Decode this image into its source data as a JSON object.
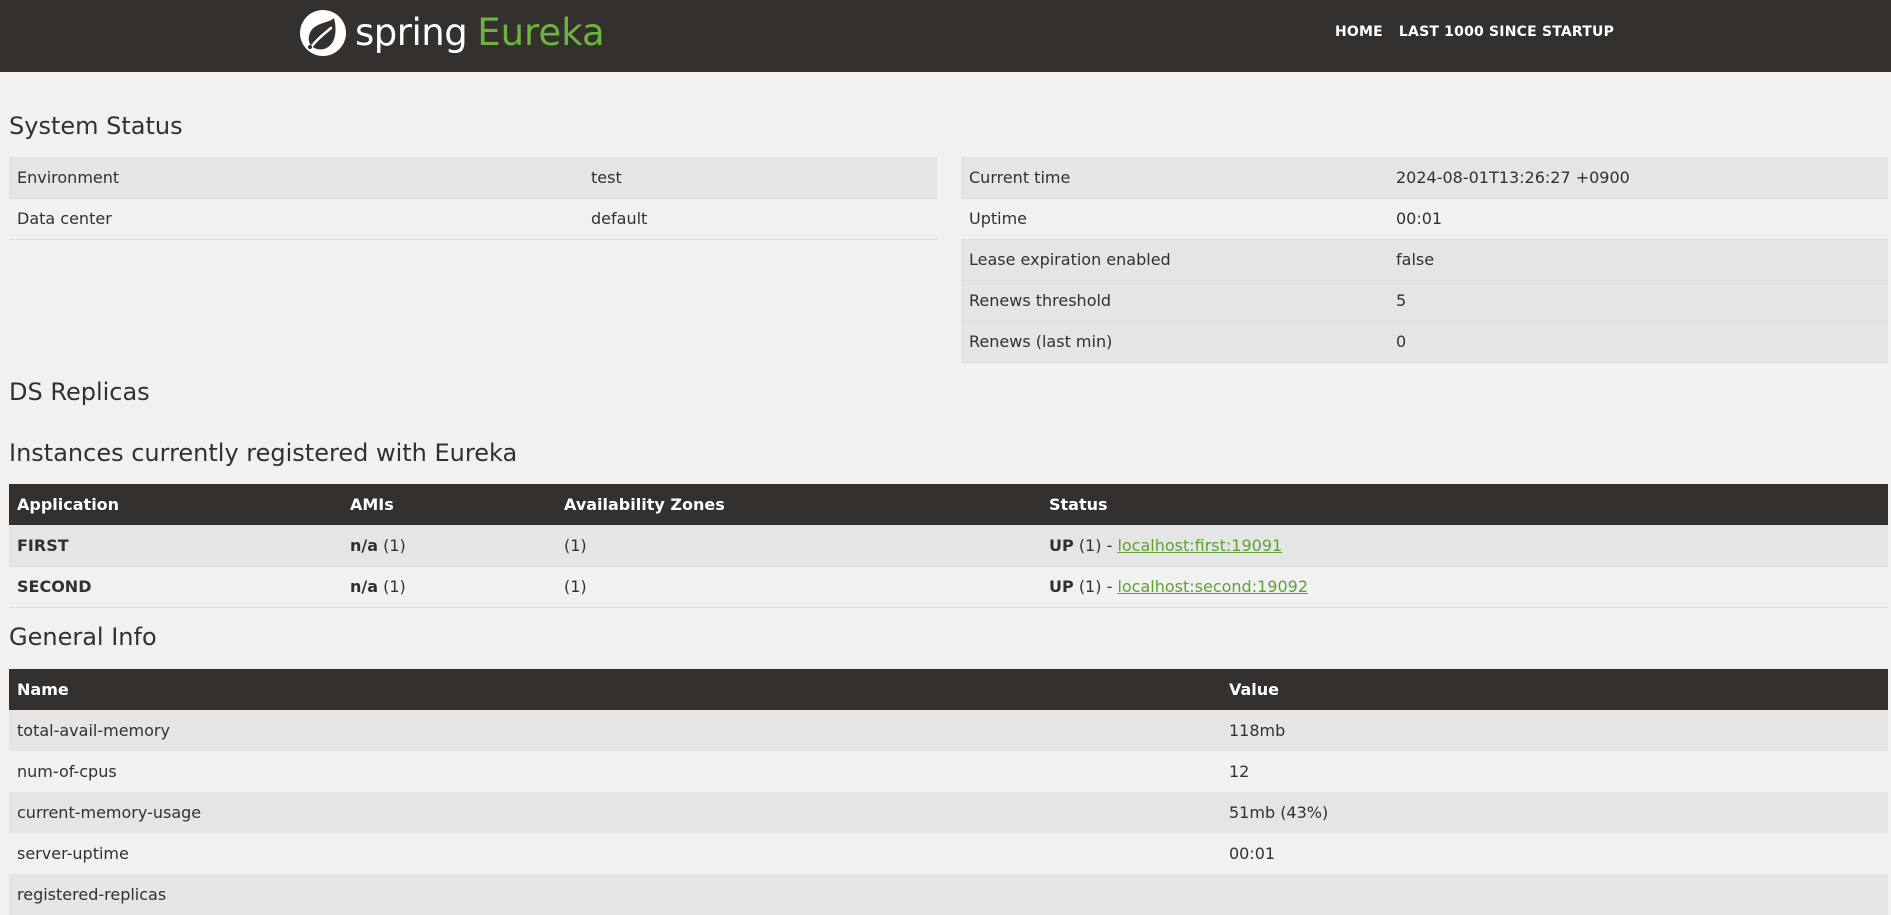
{
  "brand": {
    "spring": "spring",
    "eureka": "Eureka",
    "eureka_color": "#6db33f",
    "logo_icon": "spring-leaf-icon"
  },
  "nav": {
    "home": "HOME",
    "last1000": "LAST 1000 SINCE STARTUP"
  },
  "system_status": {
    "title": "System Status",
    "left": [
      {
        "label": "Environment",
        "value": "test"
      },
      {
        "label": "Data center",
        "value": "default"
      }
    ],
    "right": [
      {
        "label": "Current time",
        "value": "2024-08-01T13:26:27 +0900"
      },
      {
        "label": "Uptime",
        "value": "00:01"
      },
      {
        "label": "Lease expiration enabled",
        "value": "false"
      },
      {
        "label": "Renews threshold",
        "value": "5"
      },
      {
        "label": "Renews (last min)",
        "value": "0"
      }
    ]
  },
  "ds_replicas": {
    "title": "DS Replicas"
  },
  "instances": {
    "title": "Instances currently registered with Eureka",
    "headers": [
      "Application",
      "AMIs",
      "Availability Zones",
      "Status"
    ],
    "rows": [
      {
        "app": "FIRST",
        "ami_bold": "n/a",
        "ami_count": "(1)",
        "zones": "(1)",
        "status_bold": "UP",
        "status_count": "(1) -",
        "link": "localhost:first:19091"
      },
      {
        "app": "SECOND",
        "ami_bold": "n/a",
        "ami_count": "(1)",
        "zones": "(1)",
        "status_bold": "UP",
        "status_count": "(1) -",
        "link": "localhost:second:19092"
      }
    ]
  },
  "general_info": {
    "title": "General Info",
    "headers": [
      "Name",
      "Value"
    ],
    "rows": [
      {
        "name": "total-avail-memory",
        "value": "118mb"
      },
      {
        "name": "num-of-cpus",
        "value": "12"
      },
      {
        "name": "current-memory-usage",
        "value": "51mb (43%)"
      },
      {
        "name": "server-uptime",
        "value": "00:01"
      },
      {
        "name": "registered-replicas",
        "value": ""
      }
    ]
  }
}
